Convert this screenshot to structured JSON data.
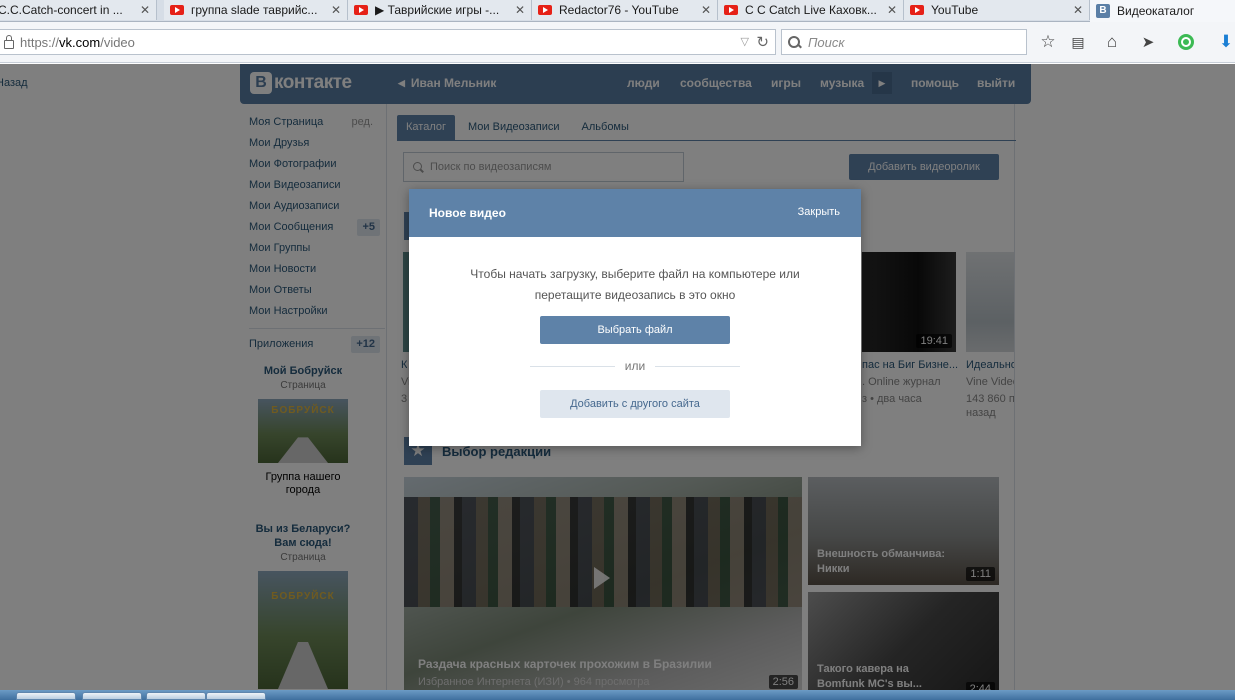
{
  "browser": {
    "tabs": [
      {
        "title": "C.C.Catch-concert in ...",
        "icon": "youtube-icon"
      },
      {
        "title": "группа slade таврийс...",
        "icon": "youtube-icon"
      },
      {
        "title": "▶ Таврийские игры -...",
        "icon": "youtube-icon"
      },
      {
        "title": "Redactor76 - YouTube",
        "icon": "youtube-icon"
      },
      {
        "title": "C C Catch Live Каховк...",
        "icon": "youtube-icon"
      },
      {
        "title": "YouTube",
        "icon": "youtube-icon"
      },
      {
        "title": "Видеокаталог",
        "icon": "vk-icon"
      }
    ],
    "url": {
      "scheme": "https://",
      "host": "vk.com",
      "path": "/video"
    },
    "search_placeholder": "Поиск"
  },
  "vk": {
    "back": "Назад",
    "logo": {
      "letter": "В",
      "word": "контакте"
    },
    "user": "Иван Мельник",
    "nav": [
      "люди",
      "сообщества",
      "игры",
      "музыка",
      "помощь",
      "выйти"
    ],
    "menu": [
      {
        "label": "Моя Страница",
        "extra": "ред."
      },
      {
        "label": "Мои Друзья"
      },
      {
        "label": "Мои Фотографии"
      },
      {
        "label": "Мои Видеозаписи"
      },
      {
        "label": "Мои Аудиозаписи"
      },
      {
        "label": "Мои Сообщения",
        "badge": "+5"
      },
      {
        "label": "Мои Группы"
      },
      {
        "label": "Мои Новости"
      },
      {
        "label": "Мои Ответы"
      },
      {
        "label": "Мои Настройки"
      },
      {
        "label": "Приложения",
        "badge": "+12"
      }
    ],
    "promo1": {
      "title": "Мой Бобруйск",
      "sub": "Страница",
      "sign": "БОБРУЙСК",
      "caption": "Группа нашего города"
    },
    "promo2": {
      "title": "Вы из Беларуси? Вам сюда!",
      "sub": "Страница",
      "sign": "БОБРУЙСК"
    },
    "tabs": [
      "Каталог",
      "Мои Видеозаписи",
      "Альбомы"
    ],
    "video_search_placeholder": "Поиск по видеозаписям",
    "add_video": "Добавить видеоролик",
    "row1": {
      "left_title": "К",
      "left_meta1": "Vi",
      "left_meta2": "3",
      "mid_title": "пас на Биг Бизне...",
      "mid_meta1": ". Online журнал",
      "mid_meta2": "з  •  два часа",
      "mid_duration": "19:41",
      "right_title": "Идеальнo",
      "right_meta1": "Vine Video",
      "right_meta2": "143 860 п",
      "right_meta3": "назад"
    },
    "editors": {
      "heading": "Выбор редакции",
      "big": {
        "title": "Раздача красных карточек прохожим в Бразилии",
        "channel": "Избранное Интернета (ИЗИ)",
        "views": "964 просмотра",
        "duration": "2:56"
      },
      "side1": {
        "title": "Внешность обманчива: Никки",
        "duration": "1:11"
      },
      "side2": {
        "title": "Такого кавера на Bomfunk MC's вы...",
        "duration": "2:44"
      }
    }
  },
  "modal": {
    "title": "Новое видео",
    "close": "Закрыть",
    "text_line1": "Чтобы начать загрузку, выберите файл на компьютере или",
    "text_line2": "перетащите видеозапись в это окно",
    "choose_file": "Выбрать файл",
    "or": "или",
    "from_other_site": "Добавить с другого сайта"
  },
  "colors": {
    "vk_blue": "#597da3",
    "button_blue": "#5e82a8",
    "link": "#2b587a"
  }
}
